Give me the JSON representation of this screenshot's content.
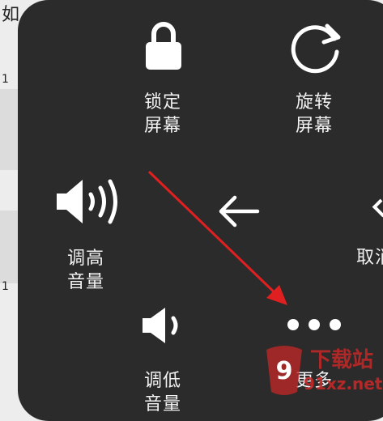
{
  "background": {
    "fragment_1": "如",
    "fragment_2": "1",
    "fragment_3": "1"
  },
  "panel": {
    "lock": {
      "line1": "锁定",
      "line2": "屏幕"
    },
    "rotate": {
      "line1": "旋转",
      "line2": "屏幕"
    },
    "volume_up": {
      "line1": "调高",
      "line2": "音量"
    },
    "cancel": {
      "line1": "取消"
    },
    "volume_down": {
      "line1": "调低",
      "line2": "音量"
    },
    "more": {
      "line1": "更多"
    }
  },
  "watermark": {
    "top": "下载站",
    "bottom": "91xz.net"
  },
  "colors": {
    "panel": "#2b2b2b",
    "text": "#f2f2f2",
    "annotation_arrow": "#e02020",
    "watermark_red": "#c62828"
  },
  "icons": [
    "lock-icon",
    "rotate-icon",
    "volume-up-icon",
    "back-arrow-icon",
    "volume-down-icon",
    "more-dots-icon"
  ]
}
